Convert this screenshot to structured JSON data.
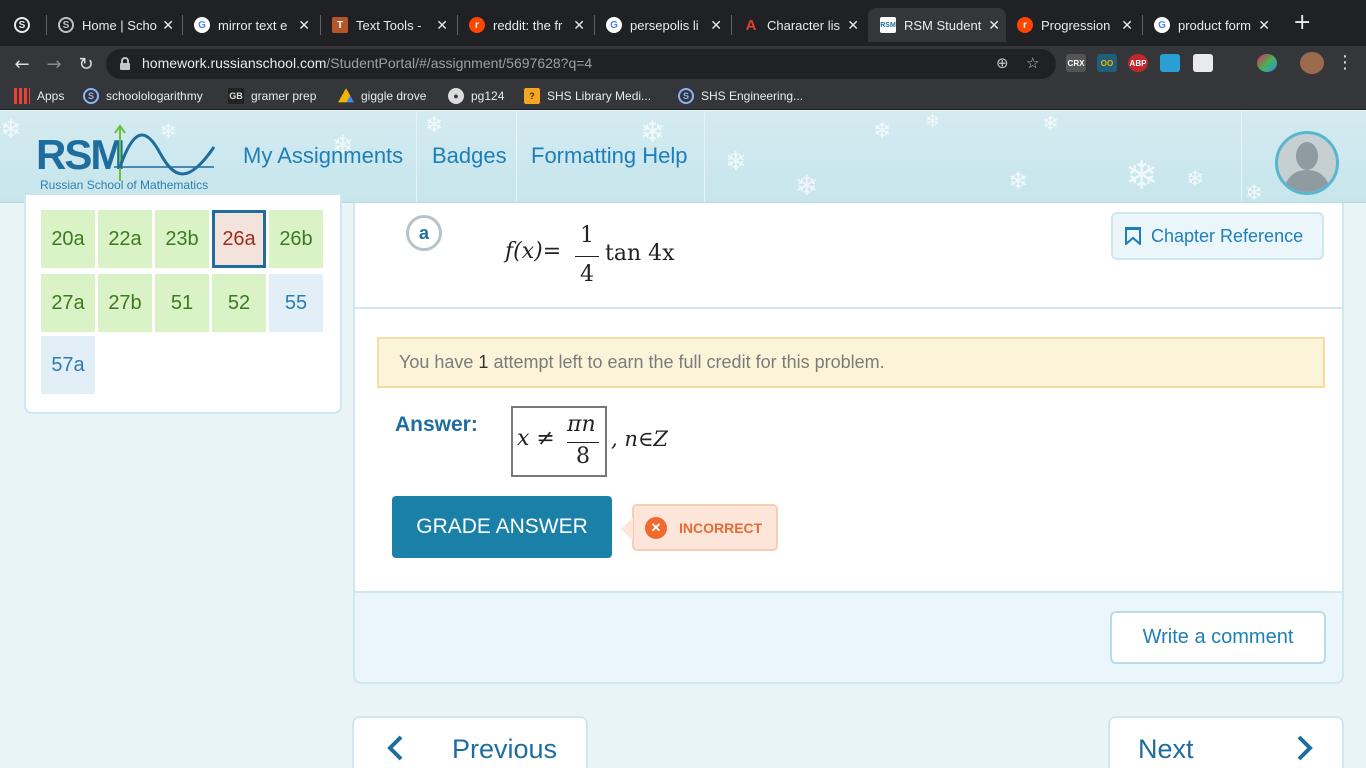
{
  "browser": {
    "tabs": [
      {
        "label": "",
        "icon": "rsm-s-icon"
      },
      {
        "label": "Home | Scho",
        "icon": "rsm-s-icon"
      },
      {
        "label": "mirror text e",
        "icon": "google-icon"
      },
      {
        "label": "Text Tools - ",
        "icon": "text-tools-icon"
      },
      {
        "label": "reddit: the fr",
        "icon": "reddit-icon"
      },
      {
        "label": "persepolis li",
        "icon": "google-icon"
      },
      {
        "label": "Character lis",
        "icon": "character-icon"
      },
      {
        "label": "RSM Student",
        "icon": "rsm-icon"
      },
      {
        "label": "Progression",
        "icon": "reddit-icon"
      },
      {
        "label": "product form",
        "icon": "google-icon"
      }
    ],
    "url_domain": "homework.russianschool.com",
    "url_path": "/StudentPortal/#/assignment/5697628?q=4",
    "extensions": [
      "CRX",
      "OO",
      "ABP",
      "EXT"
    ],
    "bookmarks": [
      {
        "label": "Apps",
        "icon": "apps-icon"
      },
      {
        "label": "schoolologarithmy",
        "icon": "schoology-icon"
      },
      {
        "label": "gramer prep",
        "icon": "gb-icon"
      },
      {
        "label": "giggle drove",
        "icon": "drive-icon"
      },
      {
        "label": "pg124",
        "icon": "globe-icon"
      },
      {
        "label": "SHS Library Medi...",
        "icon": "library-icon"
      },
      {
        "label": "SHS Engineering...",
        "icon": "schoology-icon"
      }
    ]
  },
  "header": {
    "logo_text": "RSM",
    "logo_sub": "Russian School of Mathematics",
    "nav": [
      "My Assignments",
      "Badges",
      "Formatting Help"
    ]
  },
  "problems": [
    {
      "label": "20a",
      "status": "green"
    },
    {
      "label": "22a",
      "status": "green"
    },
    {
      "label": "23b",
      "status": "green"
    },
    {
      "label": "26a",
      "status": "current"
    },
    {
      "label": "26b",
      "status": "green"
    },
    {
      "label": "27a",
      "status": "green"
    },
    {
      "label": "27b",
      "status": "green"
    },
    {
      "label": "51",
      "status": "green"
    },
    {
      "label": "52",
      "status": "green"
    },
    {
      "label": "55",
      "status": "blue"
    },
    {
      "label": "57a",
      "status": "blue"
    }
  ],
  "question": {
    "part": "a",
    "formula": {
      "lhs": "f(x)=",
      "num": "1",
      "den": "4",
      "rhs": "tan 4x"
    },
    "chapter_reference": "Chapter Reference"
  },
  "attempt": {
    "prefix": "You have",
    "count": "1",
    "suffix": "attempt left to earn the full credit for this problem."
  },
  "answer": {
    "label": "Answer:",
    "lhs": "x ≠",
    "num": "πn",
    "den": "8",
    "tail": ", n∈Z"
  },
  "grade_button": "GRADE ANSWER",
  "result_badge": "INCORRECT",
  "comment_button": "Write a comment",
  "pager": {
    "previous": "Previous",
    "next": "Next"
  },
  "colors": {
    "accent": "#1a80a8",
    "incorrect": "#f16a2d",
    "correct_cell": "#d9f3c6"
  }
}
